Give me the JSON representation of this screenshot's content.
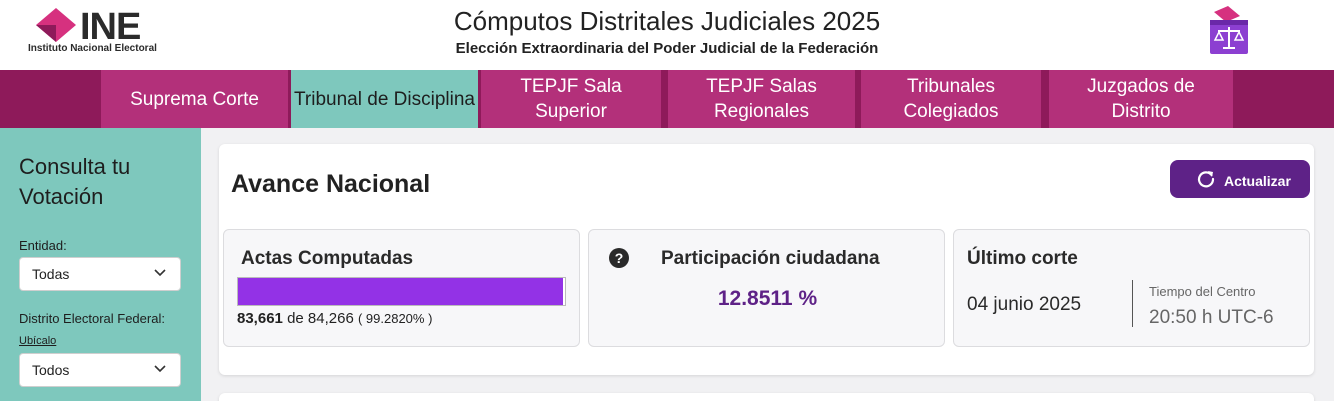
{
  "header": {
    "logo_text": "INE",
    "logo_subtitle": "Instituto Nacional Electoral",
    "title": "Cómputos Distritales Judiciales 2025",
    "subtitle": "Elección Extraordinaria del Poder Judicial de la Federación",
    "ballot_icon": "ballot-box-scales-icon"
  },
  "nav": {
    "tabs": [
      {
        "label": "Suprema Corte",
        "active": false
      },
      {
        "label": "Tribunal de Disciplina",
        "active": true
      },
      {
        "label": "TEPJF Sala Superior",
        "active": false
      },
      {
        "label": "TEPJF Salas Regionales",
        "active": false
      },
      {
        "label": "Tribunales Colegiados",
        "active": false
      },
      {
        "label": "Juzgados de Distrito",
        "active": false
      }
    ]
  },
  "sidebar": {
    "title": "Consulta tu Votación",
    "entidad_label": "Entidad:",
    "entidad_value": "Todas",
    "distrito_label": "Distrito Electoral Federal:",
    "ubicalo_link": "Ubícalo",
    "distrito_value": "Todos"
  },
  "main": {
    "title": "Avance Nacional",
    "refresh_label": "Actualizar",
    "actas": {
      "heading": "Actas Computadas",
      "computadas": "83,661",
      "de_text": "de",
      "total": "84,266",
      "percent_text": "( 99.2820% )",
      "progress_fraction": 0.99282
    },
    "participacion": {
      "heading": "Participación ciudadana",
      "value": "12.8511 %"
    },
    "corte": {
      "heading": "Último corte",
      "date": "04 junio 2025",
      "tz_label": "Tiempo del Centro",
      "time": "20:50 h UTC-6"
    }
  },
  "colors": {
    "brand_magenta": "#b3307a",
    "nav_dark": "#8e1a5a",
    "teal": "#7ec8bd",
    "purple": "#5e2287",
    "progress": "#9332e6"
  }
}
